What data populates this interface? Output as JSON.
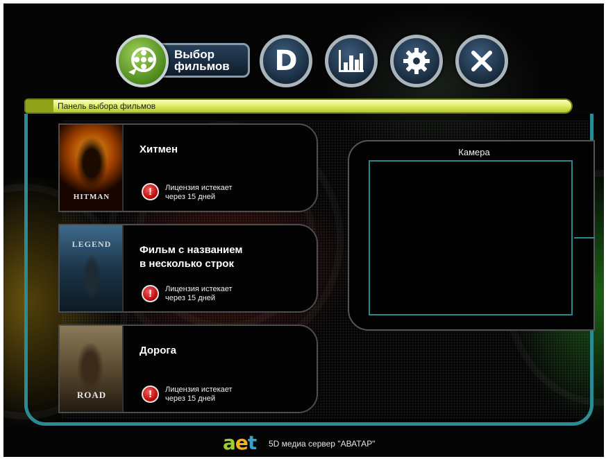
{
  "toolbar": {
    "select_films_label_line1": "Выбор",
    "select_films_label_line2": "фильмов",
    "d_button_label": "D",
    "icons": [
      "film-reel-icon",
      "stats-chart-icon",
      "gear-icon",
      "close-icon"
    ]
  },
  "panel": {
    "title": "Панель выбора фильмов"
  },
  "movies": [
    {
      "title_line1": "Хитмен",
      "title_line2": "",
      "poster_text": "HITMAN",
      "warning_symbol": "!",
      "license_line1": "Лицензия истекает",
      "license_line2": "через 15 дней"
    },
    {
      "title_line1": "Фильм с названием",
      "title_line2": "в несколько строк",
      "poster_text": "LEGEND",
      "warning_symbol": "!",
      "license_line1": "Лицензия истекает",
      "license_line2": "через 15 дней"
    },
    {
      "title_line1": "Дорога",
      "title_line2": "",
      "poster_text": "ROAD",
      "warning_symbol": "!",
      "license_line1": "Лицензия истекает",
      "license_line2": "через 15 дней"
    }
  ],
  "camera": {
    "title": "Камера"
  },
  "footer": {
    "logo_a": "a",
    "logo_e": "e",
    "logo_t": "t",
    "text": "5D медиа сервер \"АВАТАР\""
  },
  "colors": {
    "accent_teal": "#2b8b95",
    "title_bar_green": "#e3f070",
    "warning_red": "#c01010",
    "film_button_green": "#6aa82a"
  }
}
